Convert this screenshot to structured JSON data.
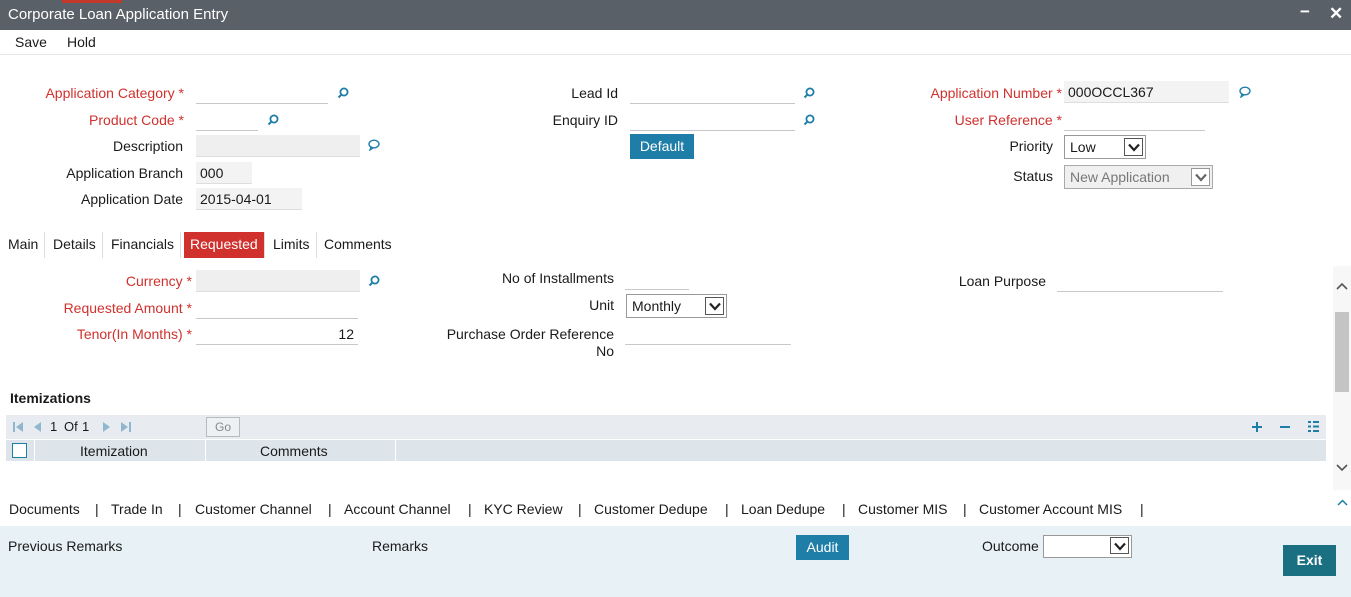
{
  "window": {
    "title": "Corporate Loan Application Entry",
    "minimize": "−",
    "close": "✕"
  },
  "menu": {
    "save": "Save",
    "hold": "Hold"
  },
  "header": {
    "application_category": {
      "label": "Application Category",
      "value": ""
    },
    "product_code": {
      "label": "Product Code",
      "value": ""
    },
    "description": {
      "label": "Description",
      "value": ""
    },
    "application_branch": {
      "label": "Application Branch",
      "value": "000"
    },
    "application_date": {
      "label": "Application Date",
      "value": "2015-04-01"
    },
    "lead_id": {
      "label": "Lead Id",
      "value": ""
    },
    "enquiry_id": {
      "label": "Enquiry ID",
      "value": ""
    },
    "default_button": "Default",
    "application_number": {
      "label": "Application Number",
      "value": "000OCCL367"
    },
    "user_reference": {
      "label": "User Reference",
      "value": ""
    },
    "priority": {
      "label": "Priority",
      "value": "Low"
    },
    "status": {
      "label": "Status",
      "value": "New Application"
    },
    "required_mark": "*"
  },
  "tabs": [
    "Main",
    "Details",
    "Financials",
    "Requested",
    "Limits",
    "Comments"
  ],
  "active_tab": "Requested",
  "requested": {
    "currency": {
      "label": "Currency",
      "value": ""
    },
    "requested_amount": {
      "label": "Requested Amount",
      "value": ""
    },
    "tenor": {
      "label": "Tenor(In Months)",
      "value": "12"
    },
    "installments": {
      "label": "No of Installments",
      "value": ""
    },
    "unit": {
      "label": "Unit",
      "value": "Monthly"
    },
    "po_ref": {
      "label_line1": "Purchase Order Reference",
      "label_line2": "No",
      "value": ""
    },
    "loan_purpose": {
      "label": "Loan Purpose",
      "value": ""
    }
  },
  "itemizations": {
    "title": "Itemizations",
    "page_current": "1",
    "page_of": "Of",
    "page_total": "1",
    "go": "Go",
    "columns": [
      "Itemization",
      "Comments"
    ]
  },
  "footer_nav": [
    "Documents",
    "Trade In",
    "Customer Channel",
    "Account Channel",
    "KYC Review",
    "Customer Dedupe",
    "Loan Dedupe",
    "Customer MIS",
    "Customer Account MIS"
  ],
  "footer_sep": "|",
  "footer": {
    "previous_remarks": "Previous Remarks",
    "remarks": "Remarks",
    "audit": "Audit",
    "outcome_label": "Outcome",
    "outcome_value": "",
    "exit": "Exit"
  },
  "colors": {
    "accent_red": "#d0312d",
    "button_blue": "#1f7ea8",
    "exit_teal": "#1a6f80",
    "titlebar": "#5a6067"
  }
}
